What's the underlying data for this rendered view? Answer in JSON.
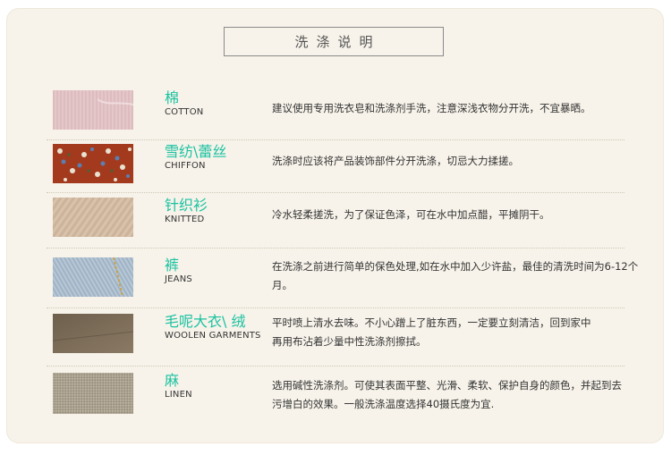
{
  "title": "洗涤说明",
  "colors": {
    "accent": "#1cc2a1",
    "background": "#f7f3ea"
  },
  "fabrics": [
    {
      "zh": "棉",
      "en": "COTTON",
      "desc": "建议使用专用洗衣皂和洗涤剂手洗，注意深浅衣物分开洗，不宜暴晒。"
    },
    {
      "zh": "雪纺\\蕾丝",
      "en": "CHIFFON",
      "desc": "洗涤时应该将产品装饰部件分开洗涤，切忌大力揉搓。"
    },
    {
      "zh": "针织衫",
      "en": "KNITTED",
      "desc": "冷水轻柔搓洗，为了保证色泽，可在水中加点醋，平摊阴干。"
    },
    {
      "zh": "裤",
      "en": "JEANS",
      "desc": "在洗涤之前进行简单的保色处理,如在水中加入少许盐，最佳的清洗时间为6-12个月。"
    },
    {
      "zh": "毛呢大衣\\ 绒",
      "en": "WOOLEN GARMENTS",
      "desc": "平时喷上清水去味。不小心蹭上了脏东西，一定要立刻清洁，回到家中再用布沾着少量中性洗涤剂擦拭。"
    },
    {
      "zh": "麻",
      "en": "LINEN",
      "desc": "选用碱性洗涤剂。可使其表面平整、光滑、柔软、保护自身的颜色，并起到去污增白的效果。一般洗涤温度选择40摄氏度为宜."
    }
  ]
}
